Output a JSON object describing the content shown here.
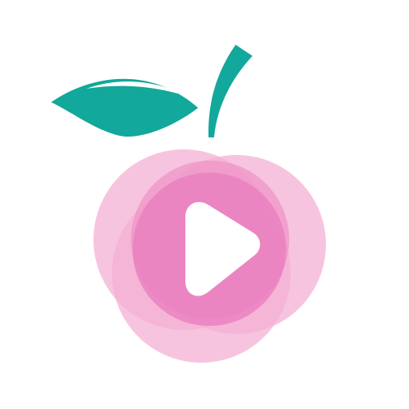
{
  "app_icon": {
    "icon_name": "peach-play-icon",
    "colors": {
      "background": "#ffffff",
      "leaf": "#12a89b",
      "leaf_vein": "#ffffff",
      "stem": "#12a89b",
      "fruit_light": "#f4b0d4",
      "fruit_mid": "#ee93c6",
      "fruit_core": "#ea7fbf",
      "play": "#ffffff"
    }
  }
}
